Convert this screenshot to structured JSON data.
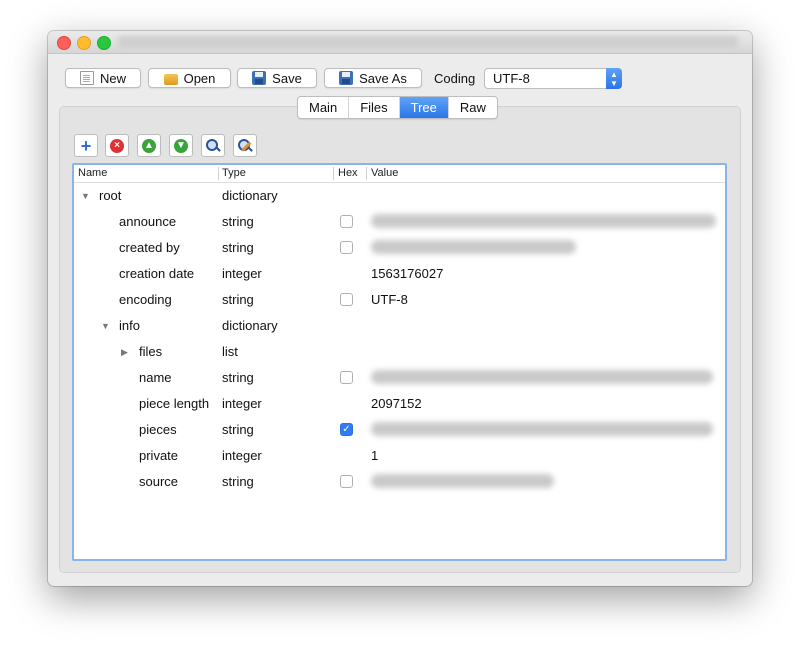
{
  "toolbar": {
    "new_label": "New",
    "open_label": "Open",
    "save_label": "Save",
    "save_as_label": "Save As",
    "coding_label": "Coding",
    "coding_value": "UTF-8"
  },
  "tabs": [
    {
      "label": "Main",
      "active": false
    },
    {
      "label": "Files",
      "active": false
    },
    {
      "label": "Tree",
      "active": true
    },
    {
      "label": "Raw",
      "active": false
    }
  ],
  "tree_toolbar": {
    "icons": [
      "add-icon",
      "remove-icon",
      "move-up-icon",
      "move-down-icon",
      "search-icon",
      "search-replace-icon"
    ]
  },
  "tree": {
    "columns": {
      "name": "Name",
      "type": "Type",
      "hex": "Hex",
      "value": "Value"
    },
    "rows": [
      {
        "name": "root",
        "type": "dictionary",
        "expanded": true
      },
      {
        "name": "announce",
        "type": "string",
        "hex": false,
        "value_redacted": true
      },
      {
        "name": "created by",
        "type": "string",
        "hex": false,
        "value_redacted": true
      },
      {
        "name": "creation date",
        "type": "integer",
        "value": "1563176027"
      },
      {
        "name": "encoding",
        "type": "string",
        "hex": false,
        "value": "UTF-8"
      },
      {
        "name": "info",
        "type": "dictionary",
        "expanded": true
      },
      {
        "name": "files",
        "type": "list",
        "expanded": false
      },
      {
        "name": "name",
        "type": "string",
        "hex": false,
        "value_redacted": true
      },
      {
        "name": "piece length",
        "type": "integer",
        "value": "2097152"
      },
      {
        "name": "pieces",
        "type": "string",
        "hex": true,
        "value_redacted": true
      },
      {
        "name": "private",
        "type": "integer",
        "value": "1"
      },
      {
        "name": "source",
        "type": "string",
        "hex": false,
        "value_redacted": true
      }
    ]
  },
  "colors": {
    "accent": "#2b77ea",
    "close": "#fe5f57",
    "minimize": "#febc2e",
    "maximize": "#28c840"
  }
}
